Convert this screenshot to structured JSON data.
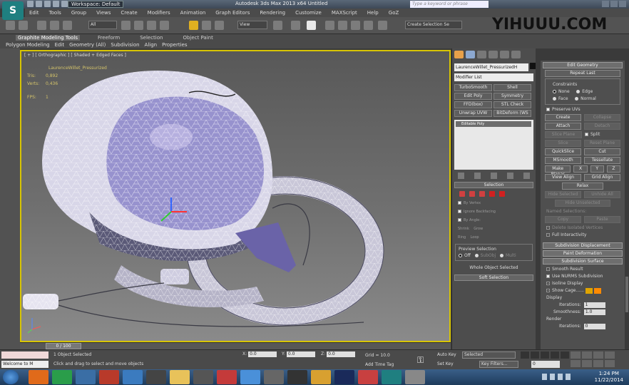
{
  "titlebar": {
    "workspace": "Workspace: Default",
    "title": "Autodesk 3ds Max  2013 x64     Untitled",
    "search_placeholder": "Type a keyword or phrase"
  },
  "menu": [
    "Edit",
    "Tools",
    "Group",
    "Views",
    "Create",
    "Modifiers",
    "Animation",
    "Graph Editors",
    "Rendering",
    "Customize",
    "MAXScript",
    "Help",
    "GoZ"
  ],
  "toolbar": {
    "filter": "All",
    "ref_coord": "View",
    "named_selection": "Create Selection Se"
  },
  "watermark": "YIHUUU.COM",
  "ribbon": {
    "tabs": [
      "Graphite Modeling Tools",
      "Freeform",
      "Selection",
      "Object Paint"
    ],
    "subtabs": [
      "Polygon Modeling",
      "Edit",
      "Geometry (All)",
      "Subdivision",
      "Align",
      "Properties"
    ]
  },
  "viewport": {
    "label": "[ + ] [ Orthographic ] [ Shaded + Edged Faces ]",
    "stats_object": "LaurenceWillet_Pressurized",
    "stats": [
      {
        "label": "Tris:",
        "value": "0,892"
      },
      {
        "label": "Verts:",
        "value": "0,436"
      },
      {
        "label": "FPS:",
        "value": "1"
      }
    ]
  },
  "timeline": {
    "frame": "0 / 100"
  },
  "command_panel": {
    "object_name": "LaurenceWillet_PressurizedH",
    "modifier_list": "Modifier List",
    "buttons": [
      "TurboSmooth",
      "Shell",
      "Edit Poly",
      "Symmetry",
      "FFD(box)",
      "STL Check",
      "Unwrap UVW",
      "BitDeform (WS"
    ],
    "stack_item": "Editable Poly",
    "selection_head": "Selection",
    "selection_rows": [
      "By Vertex",
      "Ignore Backfacing",
      "By Angle:",
      "Shrink",
      "Grow",
      "Ring",
      "Loop"
    ],
    "preview_label": "Preview Selection",
    "preview_options": [
      "Off",
      "SubObj",
      "Multi"
    ],
    "whole_object": "Whole Object Selected",
    "soft_selection": "Soft Selection"
  },
  "edit_geometry": {
    "head": "Edit Geometry",
    "repeat_last": "Repeat Last",
    "constraints_label": "Constraints",
    "constraints": [
      "None",
      "Edge",
      "Face",
      "Normal"
    ],
    "preserve_uvs": "Preserve UVs",
    "create": "Create",
    "collapse": "Collapse",
    "attach": "Attach",
    "detach": "Detach",
    "slice_plane": "Slice Plane",
    "split": "Split",
    "slice": "Slice",
    "reset_plane": "Reset Plane",
    "quickslice": "QuickSlice",
    "cut": "Cut",
    "msmooth": "MSmooth",
    "tessellate": "Tessellate",
    "make_planar": "Make Planar",
    "xyz": [
      "X",
      "Y",
      "Z"
    ],
    "view_align": "View Align",
    "grid_align": "Grid Align",
    "relax": "Relax",
    "hide_selected": "Hide Selected",
    "unhide_all": "Unhide All",
    "hide_unselected": "Hide Unselected",
    "named_selections": "Named Selections:",
    "copy": "Copy",
    "paste": "Paste",
    "delete_isolated": "Delete Isolated Vertices",
    "full_interactivity": "Full Interactivity",
    "subdiv_displacement": "Subdivision Displacement",
    "paint_deformation": "Paint Deformation",
    "subdiv_surface": "Subdivision Surface",
    "smooth_result": "Smooth Result",
    "use_nurms": "Use NURMS Subdivision",
    "isoline": "Isoline Display",
    "show_cage": "Show Cage......",
    "display_label": "Display",
    "iterations_label": "Iterations:",
    "iterations": "1",
    "smoothness_label": "Smoothness:",
    "smoothness": "1.0",
    "render_label": "Render",
    "render_iterations_label": "Iterations:",
    "render_iterations": "0"
  },
  "statusbar": {
    "welcome": "Welcome to M",
    "object_selected": "1 Object Selected",
    "prompt": "Click and drag to select and move objects",
    "x_label": "X:",
    "x": "0.0",
    "y_label": "Y:",
    "y": "0.0",
    "z_label": "Z:",
    "z": "0.0",
    "grid": "Grid = 10.0",
    "add_time_tag": "Add Time Tag",
    "auto_key": "Auto Key",
    "set_key": "Set Key",
    "selected": "Selected",
    "key_filters": "Key Filters...",
    "frame": "0"
  },
  "taskbar": {
    "time": "1:24 PM",
    "date": "11/22/2014"
  },
  "colors": {
    "viewport_border": "#d7c400",
    "cage_swatch_1": "#e0a400",
    "cage_swatch_2": "#ff8a00",
    "sel_red": "#d02020"
  }
}
